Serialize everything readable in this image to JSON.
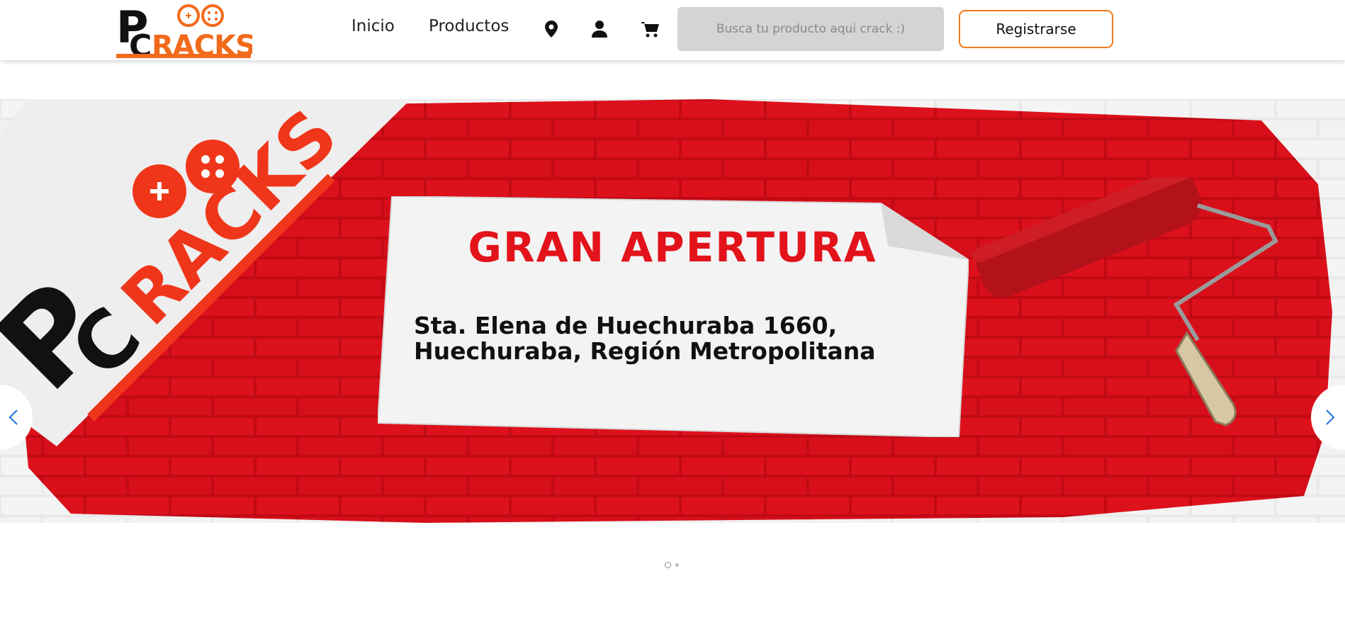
{
  "header": {
    "logo_text": "PCRACKS",
    "nav": [
      "Inicio",
      "Productos"
    ],
    "icons": [
      "location-pin-icon",
      "user-icon",
      "cart-icon"
    ],
    "search_placeholder": "Busca tu producto aqui crack :)",
    "register_label": "Registrarse",
    "accent_color": "#f07a1a"
  },
  "banner": {
    "logo_text": "PCRACKS",
    "title": "GRAN APERTURA",
    "address_line1": "Sta. Elena de Huechuraba 1660,",
    "address_line2": "Huechuraba, Región Metropolitana",
    "brand_red": "#e3131b",
    "slide_count": 2,
    "active_slide": 1
  }
}
